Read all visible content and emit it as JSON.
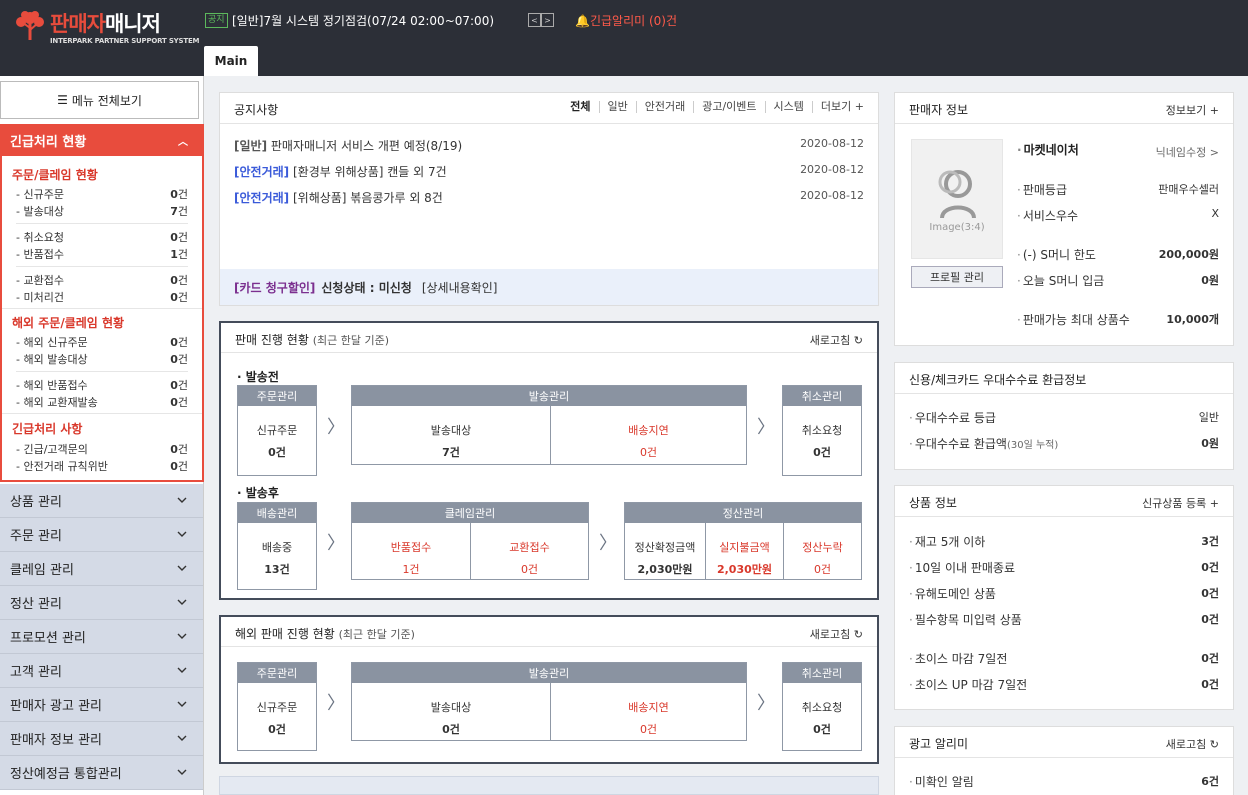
{
  "header": {
    "logo_title": "판매자",
    "logo_title_2": "매니저",
    "logo_sub": "INTERPARK PARTNER SUPPORT SYSTEM",
    "notice_badge": "공지",
    "notice_text": "[일반]7월 시스템 정기점검(07/24 02:00~07:00)",
    "pager_prev": "<",
    "pager_next": ">",
    "alert_text": "긴급알리미 (0)건",
    "tab_main": "Main"
  },
  "sidebar": {
    "menu_all": "메뉴 전체보기",
    "urgent_title": "긴급처리 현황",
    "sections": [
      {
        "title": "주문/클레임 현황",
        "rows": [
          {
            "label": "- 신규주문",
            "value": "0",
            "unit": "건"
          },
          {
            "label": "- 발송대상",
            "value": "7",
            "unit": "건"
          },
          {
            "label": "- 취소요청",
            "value": "0",
            "unit": "건"
          },
          {
            "label": "- 반품접수",
            "value": "1",
            "unit": "건"
          },
          {
            "label": "- 교환접수",
            "value": "0",
            "unit": "건"
          },
          {
            "label": "- 미처리건",
            "value": "0",
            "unit": "건"
          }
        ]
      },
      {
        "title": "해외 주문/클레임 현황",
        "rows": [
          {
            "label": "- 해외 신규주문",
            "value": "0",
            "unit": "건"
          },
          {
            "label": "- 해외 발송대상",
            "value": "0",
            "unit": "건"
          },
          {
            "label": "- 해외 반품접수",
            "value": "0",
            "unit": "건"
          },
          {
            "label": "- 해외 교환재발송",
            "value": "0",
            "unit": "건"
          }
        ]
      },
      {
        "title": "긴급처리 사항",
        "rows": [
          {
            "label": "- 긴급/고객문의",
            "value": "0",
            "unit": "건"
          },
          {
            "label": "- 안전거래 규칙위반",
            "value": "0",
            "unit": "건"
          }
        ]
      }
    ],
    "nav": [
      "상품 관리",
      "주문 관리",
      "클레임 관리",
      "정산 관리",
      "프로모션 관리",
      "고객 관리",
      "판매자 광고 관리",
      "판매자 정보 관리",
      "정산예정금 통합관리"
    ]
  },
  "notice": {
    "title": "공지사항",
    "tabs": [
      "전체",
      "일반",
      "안전거래",
      "광고/이벤트",
      "시스템",
      "더보기 +"
    ],
    "items": [
      {
        "category": "[일반]",
        "text": "판매자매니저 서비스 개편 예정(8/19)",
        "date": "2020-08-12",
        "blue": false
      },
      {
        "category": "[안전거래]",
        "text": "[환경부 위해상품] 캔들 외 7건",
        "date": "2020-08-12",
        "blue": true
      },
      {
        "category": "[안전거래]",
        "text": "[위해상품] 볶음콩가루 외 8건",
        "date": "2020-08-12",
        "blue": true
      }
    ],
    "card_title": "[카드 청구할인]",
    "card_status": "신청상태 : 미신청",
    "card_link": "[상세내용확인]"
  },
  "sales": {
    "title": "판매 진행 현황",
    "subtitle": "(최근 한달 기준)",
    "refresh": "새로고침",
    "before_label": "· 발송전",
    "after_label": "· 발송후",
    "order_mgmt": "주문관리",
    "ship_mgmt": "발송관리",
    "cancel_mgmt": "취소관리",
    "delivery_mgmt": "배송관리",
    "claim_mgmt": "클레임관리",
    "settle_mgmt": "정산관리",
    "new_order": "신규주문",
    "new_order_val": "0건",
    "ship_target": "발송대상",
    "ship_target_val": "7건",
    "ship_delay": "배송지연",
    "ship_delay_val": "0건",
    "cancel_req": "취소요청",
    "cancel_req_val": "0건",
    "delivering": "배송중",
    "delivering_val": "13건",
    "return_recv": "반품접수",
    "return_recv_val": "1건",
    "exchange_recv": "교환접수",
    "exchange_recv_val": "0건",
    "settle_confirmed": "정산확정금액",
    "settle_confirmed_val": "2,030만원",
    "unpaid": "실지불금액",
    "unpaid_val": "2,030만원",
    "settle_missing": "정산누락",
    "settle_missing_val": "0건"
  },
  "overseas": {
    "title": "해외 판매 진행 현황",
    "subtitle": "(최근 한달 기준)",
    "refresh": "새로고침",
    "order_mgmt": "주문관리",
    "ship_mgmt": "발송관리",
    "cancel_mgmt": "취소관리",
    "new_order": "신규주문",
    "new_order_val": "0건",
    "ship_target": "발송대상",
    "ship_target_val": "0건",
    "ship_delay": "배송지연",
    "ship_delay_val": "0건",
    "cancel_req": "취소요청",
    "cancel_req_val": "0건"
  },
  "seller": {
    "title": "판매자 정보",
    "more": "정보보기 +",
    "image_text": "Image(3:4)",
    "profile_btn": "프로필 관리",
    "name": "마켓네이처",
    "nickname_edit": "닉네임수정 >",
    "rows": [
      {
        "label": "판매등급",
        "value": "판매우수셀러"
      },
      {
        "label": "서비스우수",
        "value": "X"
      },
      {
        "label": "(-) S머니 한도",
        "value": "200,000원"
      },
      {
        "label": "오늘 S머니 입금",
        "value": "0원"
      },
      {
        "label": "판매가능 최대 상품수",
        "value": "10,000개"
      }
    ]
  },
  "card_fee": {
    "title": "신용/체크카드 우대수수료 환급정보",
    "rows": [
      {
        "label": "우대수수료 등급",
        "note": "",
        "value": "일반"
      },
      {
        "label": "우대수수료 환급액",
        "note": "(30일 누적)",
        "value": "0원"
      }
    ]
  },
  "product": {
    "title": "상품 정보",
    "link": "신규상품 등록 +",
    "rows": [
      {
        "label": "재고 5개 이하",
        "value": "3건"
      },
      {
        "label": "10일 이내 판매종료",
        "value": "0건"
      },
      {
        "label": "유해도메인 상품",
        "value": "0건"
      },
      {
        "label": "필수항목 미입력 상품",
        "value": "0건"
      },
      {
        "label": "초이스 마감 7일전",
        "value": "0건"
      },
      {
        "label": "초이스 UP 마감 7일전",
        "value": "0건"
      }
    ]
  },
  "ad": {
    "title": "광고 알리미",
    "refresh": "새로고침",
    "rows": [
      {
        "label": "미확인 알림",
        "value": "6건"
      }
    ]
  },
  "colors": {
    "accent_red": "#e84c3d",
    "topbar": "#2c2f37",
    "nav_bg": "#d4dae6",
    "notice_blue": "#3a5ad9",
    "card_purple": "#7b2f8f"
  }
}
